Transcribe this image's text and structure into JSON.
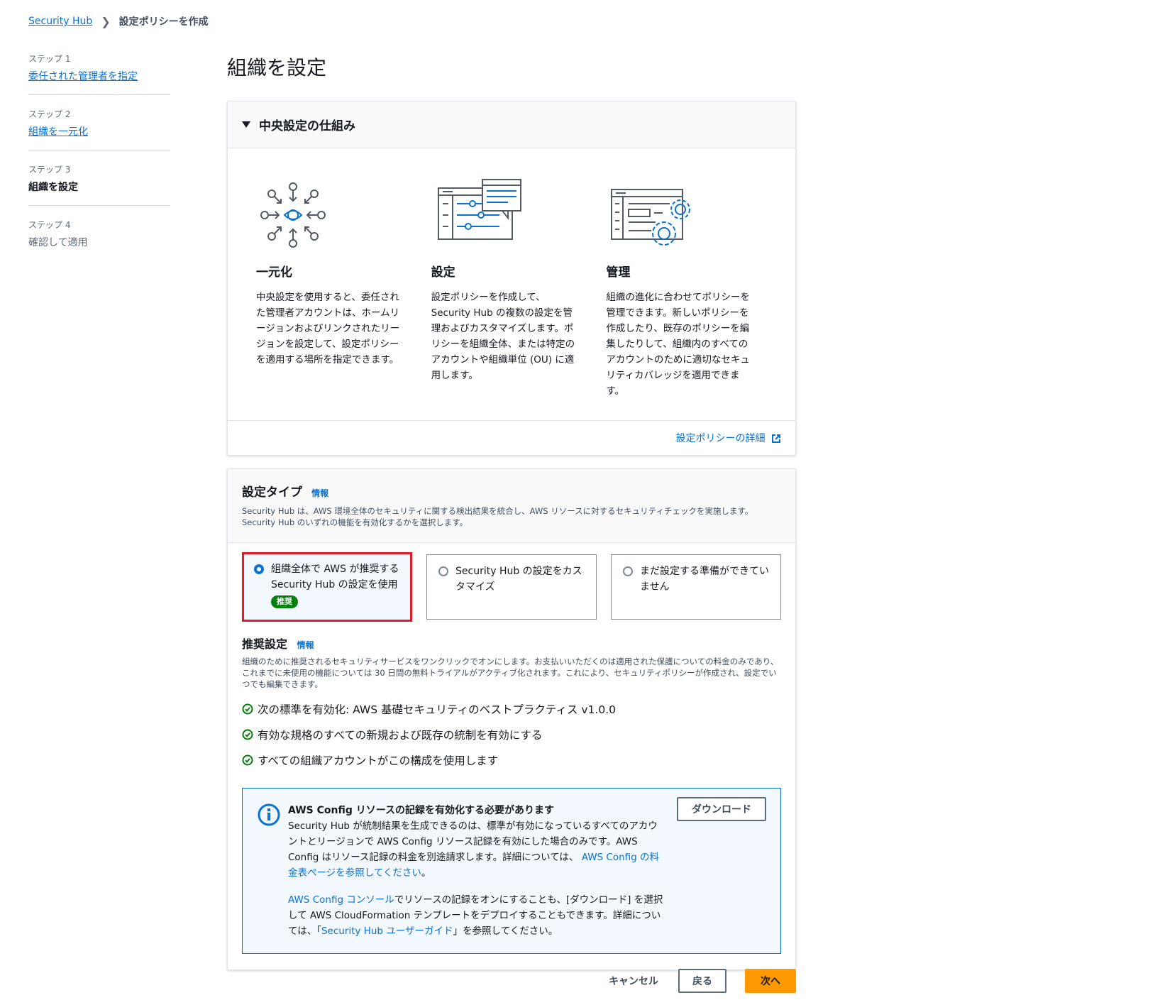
{
  "breadcrumb": {
    "root": "Security Hub",
    "current": "設定ポリシーを作成"
  },
  "steps": [
    {
      "num": "ステップ 1",
      "label": "委任された管理者を指定"
    },
    {
      "num": "ステップ 2",
      "label": "組織を一元化"
    },
    {
      "num": "ステップ 3",
      "label": "組織を設定"
    },
    {
      "num": "ステップ 4",
      "label": "確認して適用"
    }
  ],
  "page": {
    "title": "組織を設定"
  },
  "how_it_works": {
    "header": "中央設定の仕組み",
    "features": [
      {
        "title": "一元化",
        "desc": "中央設定を使用すると、委任された管理者アカウントは、ホームリージョンおよびリンクされたリージョンを設定して、設定ポリシーを適用する場所を指定できます。",
        "icon": "centralize-icon"
      },
      {
        "title": "設定",
        "desc": "設定ポリシーを作成して、Security Hub の複数の設定を管理およびカスタマイズします。ポリシーを組織全体、または特定のアカウントや組織単位 (OU) に適用します。",
        "icon": "configure-icon"
      },
      {
        "title": "管理",
        "desc": "組織の進化に合わせてポリシーを管理できます。新しいポリシーを作成したり、既存のポリシーを編集したりして、組織内のすべてのアカウントのために適切なセキュリティカバレッジを適用できます。",
        "icon": "manage-icon"
      }
    ],
    "footer_link": "設定ポリシーの詳細"
  },
  "config_type": {
    "title": "設定タイプ",
    "info": "情報",
    "desc_line1": "Security Hub は、AWS 環境全体のセキュリティに関する検出結果を統合し、AWS リソースに対するセキュリティチェックを実施します。",
    "desc_line2": "Security Hub のいずれの機能を有効化するかを選択します。",
    "options": [
      {
        "label": "組織全体で AWS が推奨する Security Hub の設定を使用",
        "badge": "推奨",
        "selected": true
      },
      {
        "label": "Security Hub の設定をカスタマイズ",
        "selected": false
      },
      {
        "label": "まだ設定する準備ができていません",
        "selected": false
      }
    ]
  },
  "recommended": {
    "title": "推奨設定",
    "info": "情報",
    "desc": "組織のために推奨されるセキュリティサービスをワンクリックでオンにします。お支払いいただくのは適用された保護についての料金のみであり、これまでに未使用の機能については 30 日間の無料トライアルがアクティブ化されます。これにより、セキュリティポリシーが作成され、設定でいつでも編集できます。",
    "checks": [
      "次の標準を有効化: AWS 基礎セキュリティのベストプラクティス v1.0.0",
      "有効な規格のすべての新規および既存の統制を有効にする",
      "すべての組織アカウントがこの構成を使用します"
    ]
  },
  "alert": {
    "title": "AWS Config リソースの記録を有効化する必要があります",
    "p1_text": "Security Hub が統制結果を生成できるのは、標準が有効になっているすべてのアカウントとリージョンで AWS Config リソース記録を有効にした場合のみです。AWS Config はリソース記録の料金を別途請求します。詳細については、",
    "p1_link": "AWS Config の料金表ページを参照してください",
    "p1_end": "。",
    "p2_link1": "AWS Config コンソール",
    "p2_text1": "でリソースの記録をオンにすることも、[ダウンロード] を選択して AWS CloudFormation テンプレートをデプロイすることもできます。詳細については、「",
    "p2_link2": "Security Hub ユーザーガイド",
    "p2_text2": "」を参照してください。",
    "download_button": "ダウンロード"
  },
  "actions": {
    "cancel": "キャンセル",
    "back": "戻る",
    "next": "次へ"
  },
  "colors": {
    "link": "#0972d3",
    "primary": "#ff9900",
    "success": "#037f0c",
    "highlight": "#e01c2a"
  }
}
